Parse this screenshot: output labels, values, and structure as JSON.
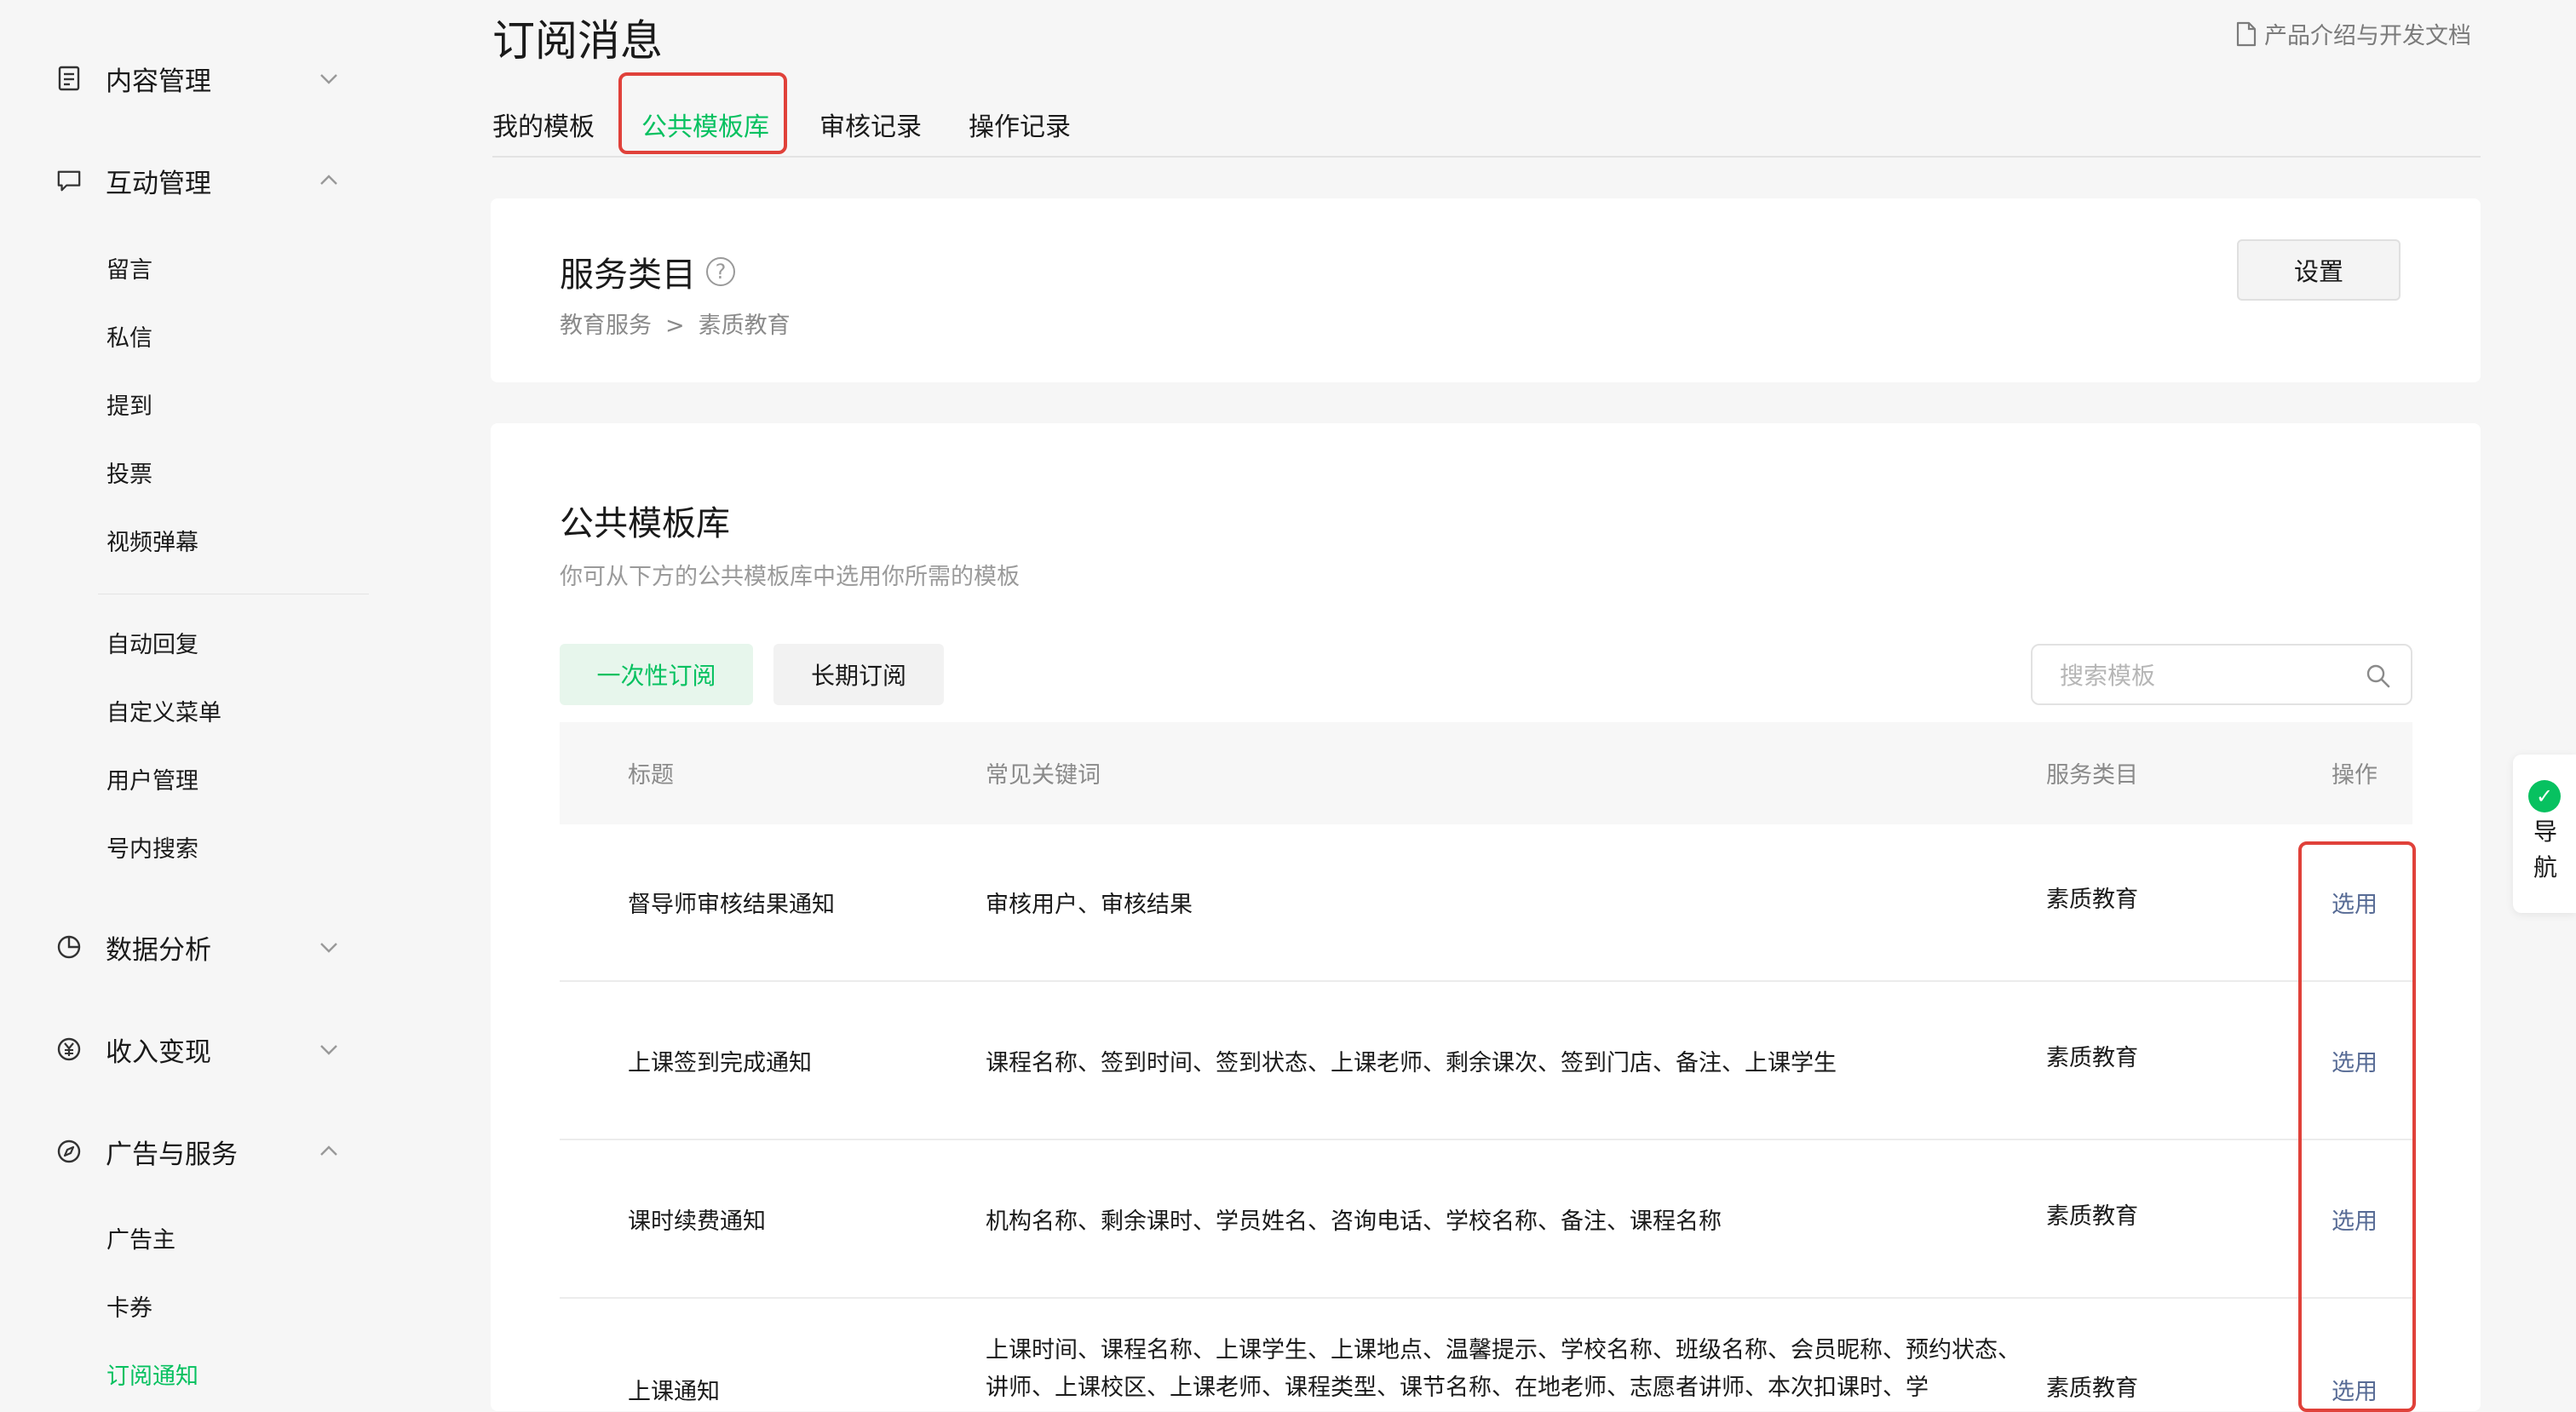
{
  "sidebar": {
    "groups": [
      {
        "label": "内容管理",
        "icon": "document-icon",
        "expanded": false
      },
      {
        "label": "互动管理",
        "icon": "chat-bubble-icon",
        "expanded": true
      },
      {
        "label": "数据分析",
        "icon": "pie-chart-icon",
        "expanded": false
      },
      {
        "label": "收入变现",
        "icon": "yen-coin-icon",
        "expanded": false
      },
      {
        "label": "广告与服务",
        "icon": "compass-icon",
        "expanded": true
      }
    ],
    "interaction_items": [
      "留言",
      "私信",
      "提到",
      "投票",
      "视频弹幕",
      "自动回复",
      "自定义菜单",
      "用户管理",
      "号内搜索"
    ],
    "ad_items": [
      "广告主",
      "卡券",
      "订阅通知"
    ],
    "active_item": "订阅通知"
  },
  "header": {
    "title": "订阅消息",
    "doc_link": "产品介绍与开发文档",
    "tabs": [
      "我的模板",
      "公共模板库",
      "审核记录",
      "操作记录"
    ],
    "active_tab": "公共模板库"
  },
  "service": {
    "title": "服务类目",
    "crumb": [
      "教育服务",
      ">",
      "素质教育"
    ],
    "settings_label": "设置"
  },
  "library": {
    "title": "公共模板库",
    "description": "你可从下方的公共模板库中选用你所需的模板",
    "segments": [
      "一次性订阅",
      "长期订阅"
    ],
    "active_segment": "一次性订阅",
    "search_placeholder": "搜索模板",
    "columns": [
      "标题",
      "常见关键词",
      "服务类目",
      "操作"
    ],
    "rows": [
      {
        "title": "督导师审核结果通知",
        "keywords": "审核用户、审核结果",
        "category": "素质教育",
        "action": "选用"
      },
      {
        "title": "上课签到完成通知",
        "keywords": "课程名称、签到时间、签到状态、上课老师、剩余课次、签到门店、备注、上课学生",
        "category": "素质教育",
        "action": "选用"
      },
      {
        "title": "课时续费通知",
        "keywords": "机构名称、剩余课时、学员姓名、咨询电话、学校名称、备注、课程名称",
        "category": "素质教育",
        "action": "选用"
      },
      {
        "title": "上课通知",
        "keywords": "上课时间、课程名称、上课学生、上课地点、温馨提示、学校名称、班级名称、会员昵称、预约状态、讲师、上课校区、上课老师、课程类型、课节名称、在地老师、志愿者讲师、本次扣课时、学",
        "category": "素质教育",
        "action": "选用"
      }
    ]
  },
  "float_nav": {
    "label": "导航"
  },
  "colors": {
    "accent": "#07c160",
    "link": "#576b95",
    "highlight": "#e0413a"
  }
}
